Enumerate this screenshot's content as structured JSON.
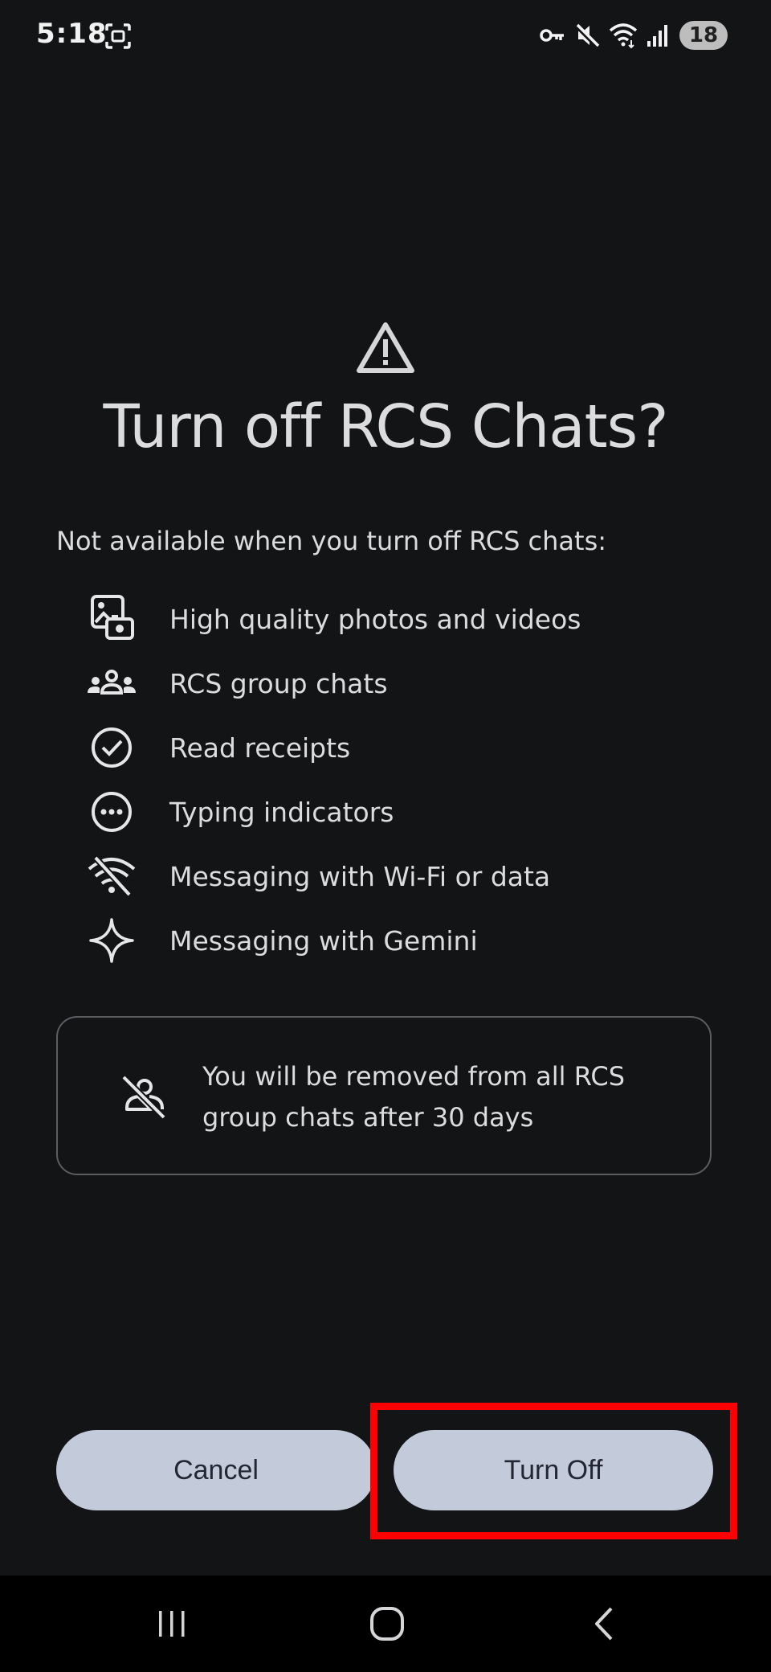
{
  "status_bar": {
    "time": "5:18",
    "battery": "18",
    "icons": [
      "screenshot-icon",
      "vpn-key-icon",
      "mute-icon",
      "wifi-icon",
      "signal-icon"
    ]
  },
  "dialog": {
    "title": "Turn off RCS Chats?",
    "intro": "Not available when you turn off RCS chats:",
    "features": [
      {
        "icon": "photo-video-icon",
        "label": "High quality photos and videos"
      },
      {
        "icon": "group-icon",
        "label": "RCS group chats"
      },
      {
        "icon": "check-circle-icon",
        "label": "Read receipts"
      },
      {
        "icon": "typing-dots-icon",
        "label": "Typing indicators"
      },
      {
        "icon": "wifi-off-icon",
        "label": "Messaging with Wi-Fi or data"
      },
      {
        "icon": "sparkle-icon",
        "label": "Messaging with Gemini"
      }
    ],
    "notice": "You will be removed from all RCS group chats after 30 days",
    "cancel_label": "Cancel",
    "confirm_label": "Turn Off"
  },
  "colors": {
    "background": "#131416",
    "button_bg": "#c3cad9",
    "button_text": "#232733",
    "highlight": "#ff0000"
  }
}
